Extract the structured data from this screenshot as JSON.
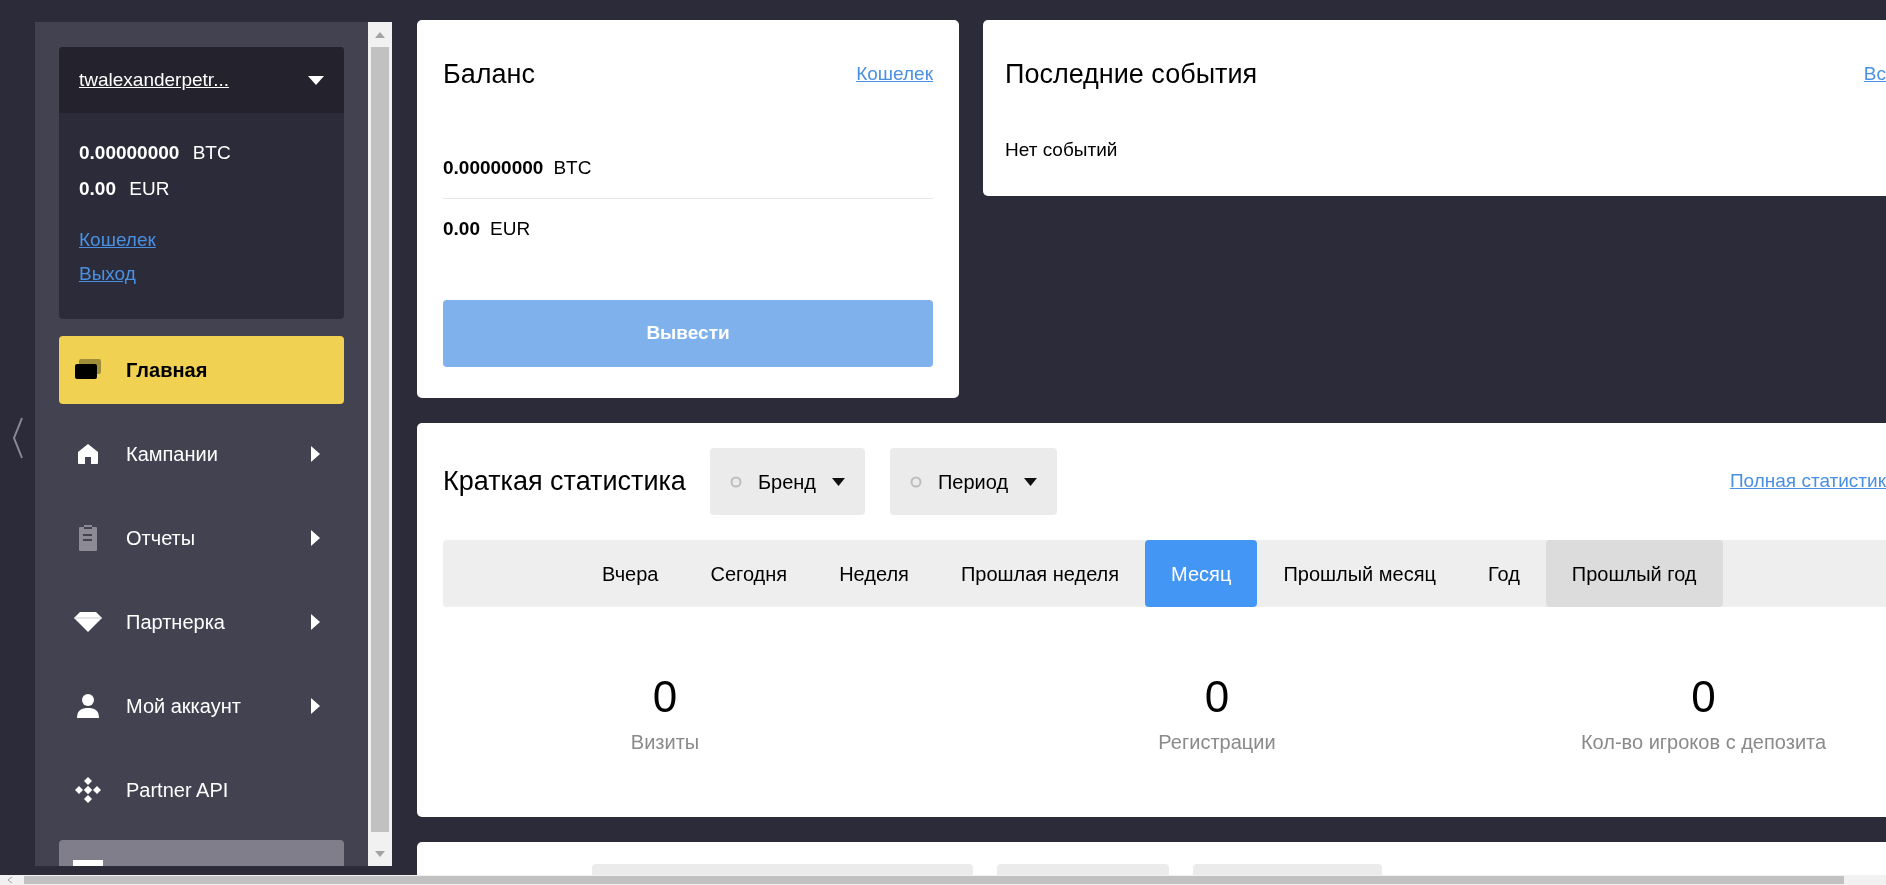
{
  "sidebar": {
    "account": {
      "username": "twalexanderpetr...",
      "balances": [
        {
          "amount": "0.00000000",
          "currency": "BTC"
        },
        {
          "amount": "0.00",
          "currency": "EUR"
        }
      ],
      "links": [
        "Кошелек",
        "Выход"
      ]
    },
    "menu": [
      {
        "label": "Главная",
        "selected": true,
        "highlighted": false,
        "submenu": false
      },
      {
        "label": "Кампании",
        "selected": false,
        "highlighted": false,
        "submenu": true
      },
      {
        "label": "Отчеты",
        "selected": false,
        "highlighted": false,
        "submenu": true
      },
      {
        "label": "Партнерка",
        "selected": false,
        "highlighted": false,
        "submenu": true
      },
      {
        "label": "Мой аккаунт",
        "selected": false,
        "highlighted": false,
        "submenu": true
      },
      {
        "label": "Partner API",
        "selected": false,
        "highlighted": false,
        "submenu": false
      },
      {
        "selected": false,
        "highlighted": true,
        "submenu": false
      }
    ]
  },
  "balance_card": {
    "title": "Баланс",
    "link": "Кошелек",
    "rows": [
      {
        "amount": "0.00000000",
        "currency": "BTC"
      },
      {
        "amount": "0.00",
        "currency": "EUR"
      }
    ],
    "button": {
      "label": "Вывести",
      "disabled": true
    }
  },
  "events_card": {
    "title": "Последние события",
    "link": "Вс",
    "empty_text": "Нет событий"
  },
  "stats_card": {
    "title": "Краткая статистика",
    "filters": [
      {
        "label": "Бренд"
      },
      {
        "label": "Период"
      }
    ],
    "link": "Полная статистик",
    "periods": [
      {
        "label": "Вчера",
        "selected": false,
        "highlighted": false
      },
      {
        "label": "Сегодня",
        "selected": false,
        "highlighted": false
      },
      {
        "label": "Неделя",
        "selected": false,
        "highlighted": false
      },
      {
        "label": "Прошлая неделя",
        "selected": false,
        "highlighted": false
      },
      {
        "label": "Месяц",
        "selected": true,
        "highlighted": false
      },
      {
        "label": "Прошлый месяц",
        "selected": false,
        "highlighted": false
      },
      {
        "label": "Год",
        "selected": false,
        "highlighted": false
      },
      {
        "label": "Прошлый год",
        "selected": false,
        "highlighted": true
      }
    ],
    "metrics": [
      {
        "value": "0",
        "label": "Визиты"
      },
      {
        "value": "0",
        "label": "Регистрации"
      },
      {
        "value": "0",
        "label": "Кол-во игроков с депозита"
      }
    ]
  }
}
